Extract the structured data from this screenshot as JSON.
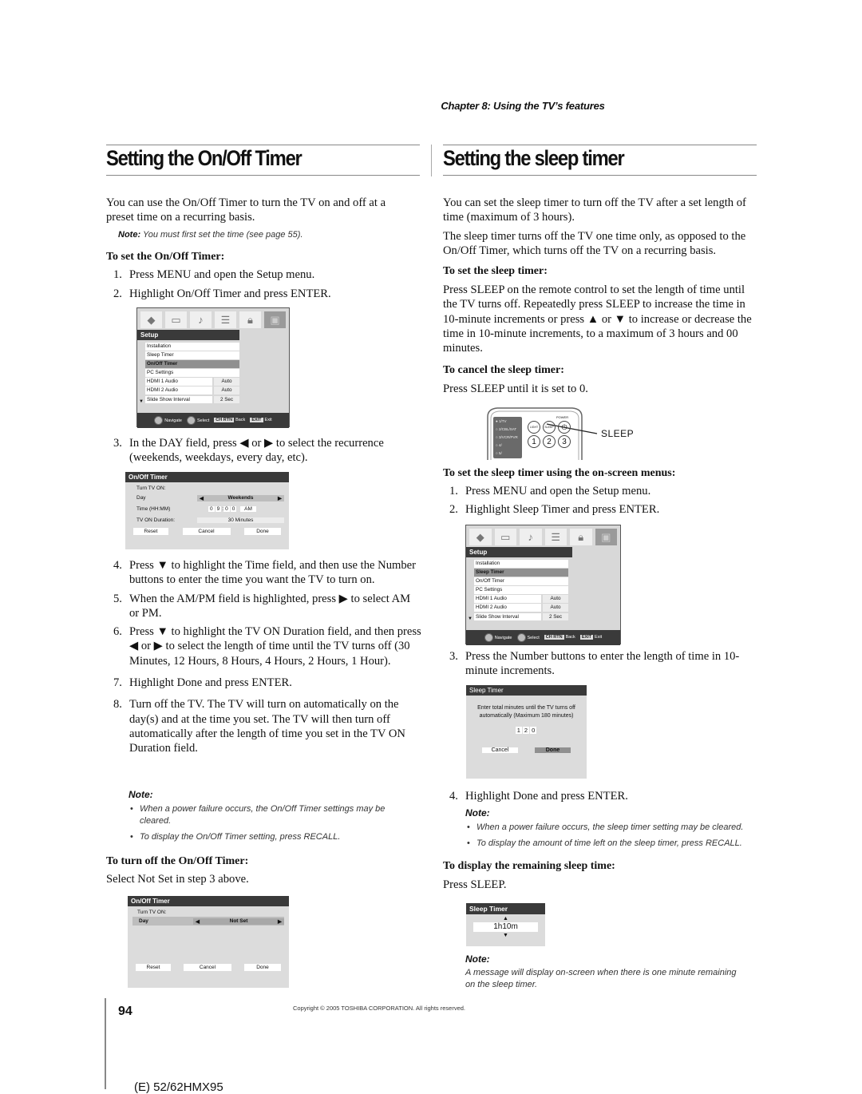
{
  "header": {
    "chapter": "Chapter 8: Using the TV’s features"
  },
  "left": {
    "title": "Setting the On/Off Timer",
    "intro": "You can use the On/Off Timer to turn the TV on and off at a preset time on a recurring basis.",
    "intro_line1": "You can use the On/Off Timer to turn the TV on and off at a",
    "intro_line2": "preset time on a recurring basis.",
    "note_label": "Note:",
    "note_text": "You must first set the time (see page 55).",
    "set_heading": "To set the On/Off Timer:",
    "steps_a": [
      {
        "n": "1.",
        "text": "Press MENU and open the Setup menu."
      },
      {
        "n": "2.",
        "text": "Highlight On/Off Timer and press ENTER."
      }
    ],
    "step3": {
      "n": "3.",
      "text": "In the DAY field, press ◀ or ▶ to select the recurrence (weekends, weekdays, every day, etc)."
    },
    "steps_b": [
      {
        "n": "4.",
        "text": "Press ▼ to highlight the Time field, and then use the Number buttons to enter the time you want the TV to turn on."
      },
      {
        "n": "5.",
        "text": "When the AM/PM field is highlighted, press ▶ to select AM or PM."
      },
      {
        "n": "6.",
        "text": "Press ▼ to highlight the TV ON Duration field, and then press ◀ or ▶ to select the length of time until the TV turns off (30 Minutes, 12 Hours, 8 Hours, 4 Hours, 2 Hours, 1 Hour)."
      },
      {
        "n": "7.",
        "text": "Highlight Done and press ENTER."
      },
      {
        "n": "8.",
        "text": "Turn off the TV. The TV will turn on automatically on the day(s) and at the time you set. The TV will then turn off automatically after the length of time you set in the TV ON Duration field."
      }
    ],
    "note2_label": "Note:",
    "note2_items": [
      "When a power failure occurs, the On/Off Timer settings may be cleared.",
      "To display the On/Off Timer setting, press RECALL."
    ],
    "turnoff_heading": "To turn off the On/Off Timer:",
    "turnoff_text": "Select Not Set in step 3 above."
  },
  "setup_menu_1": {
    "title": "Setup",
    "icons": [
      "picture-icon",
      "screen-icon",
      "music-note-icon",
      "settings-sliders-icon",
      "lock-icon",
      "setup-folder-icon"
    ],
    "items": [
      {
        "label": "Installation",
        "value": null
      },
      {
        "label": "Sleep Timer",
        "value": null
      },
      {
        "label": "On/Off Timer",
        "value": null,
        "highlighted": true
      },
      {
        "label": "PC Settings",
        "value": null
      },
      {
        "label": "HDMI 1 Audio",
        "value": "Auto"
      },
      {
        "label": "HDMI 2 Audio",
        "value": "Auto"
      },
      {
        "label": "Slide Show Interval",
        "value": "2 Sec"
      }
    ],
    "nav": {
      "navigate": "Navigate",
      "select": "Select",
      "back_key": "CH RTN",
      "back": "Back",
      "exit_key": "EXIT",
      "exit": "Exit"
    }
  },
  "onoff_dialog_1": {
    "title": "On/Off Timer",
    "turn_on_label": "Turn TV ON:",
    "day_label": "Day",
    "day_value": "Weekends",
    "time_label": "Time (HH:MM)",
    "time_digits": [
      "0",
      "9",
      "0",
      "0"
    ],
    "time_ampm": "AM",
    "duration_label": "TV ON Duration:",
    "duration_value": "30 Minutes",
    "buttons": [
      "Reset",
      "Cancel",
      "Done"
    ]
  },
  "onoff_dialog_2": {
    "title": "On/Off Timer",
    "turn_on_label": "Turn TV ON:",
    "day_label": "Day",
    "day_value": "Not Set",
    "buttons": [
      "Reset",
      "Cancel",
      "Done"
    ]
  },
  "right": {
    "title": "Setting the sleep timer",
    "intro1": "You can set the sleep timer to turn off the TV after a set length of time (maximum of 3 hours).",
    "intro2": "The sleep timer turns off the TV one time only, as opposed to the On/Off Timer, which turns off the TV on a recurring basis.",
    "set_heading": "To set the sleep timer:",
    "set_text": "Press SLEEP on the remote control to set the length of time until the TV turns off. Repeatedly press SLEEP to increase the time in 10-minute increments or press ▲ or ▼ to increase or decrease the time in 10-minute increments, to a maximum of 3 hours and 00 minutes.",
    "cancel_heading": "To cancel the sleep timer:",
    "cancel_text": "Press SLEEP until it is set to 0.",
    "menus_heading": "To set the sleep timer using the on-screen menus:",
    "steps_a": [
      {
        "n": "1.",
        "text": "Press MENU and open the Setup menu."
      },
      {
        "n": "2.",
        "text": "Highlight Sleep Timer and press ENTER."
      }
    ],
    "step3": {
      "n": "3.",
      "text": "Press the Number buttons to enter the length of time in 10-minute increments."
    },
    "step4": {
      "n": "4.",
      "text": "Highlight Done and press ENTER."
    },
    "note_label": "Note:",
    "note_items": [
      "When a power failure occurs, the sleep timer setting may be cleared.",
      "To display the amount of time left on the sleep timer, press RECALL."
    ],
    "display_heading": "To display the remaining sleep time:",
    "display_text": "Press SLEEP.",
    "note2_label": "Note:",
    "note2_text": "A message will display on-screen when there is one minute remaining on the sleep timer."
  },
  "remote": {
    "modes": [
      "1/TV",
      "2/CBL/SAT",
      "3/VCR/PVR",
      "4/",
      "5/"
    ],
    "buttons": [
      "LIGHT",
      "SLEEP",
      "POWER"
    ],
    "numbers": [
      "1",
      "2",
      "3"
    ],
    "callout": "SLEEP"
  },
  "setup_menu_2": {
    "title": "Setup",
    "items": [
      {
        "label": "Installation",
        "value": null
      },
      {
        "label": "Sleep Timer",
        "value": null,
        "highlighted": true
      },
      {
        "label": "On/Off Timer",
        "value": null
      },
      {
        "label": "PC Settings",
        "value": null
      },
      {
        "label": "HDMI 1 Audio",
        "value": "Auto"
      },
      {
        "label": "HDMI 2 Audio",
        "value": "Auto"
      },
      {
        "label": "Slide Show Interval",
        "value": "2 Sec"
      }
    ],
    "nav": {
      "navigate": "Navigate",
      "select": "Select",
      "back_key": "CH RTN",
      "back": "Back",
      "exit_key": "EXIT",
      "exit": "Exit"
    }
  },
  "sleep_dialog": {
    "title": "Sleep Timer",
    "message": "Enter total minutes until the TV turns off automatically (Maximum 180 minutes)",
    "digits": [
      "1",
      "2",
      "0"
    ],
    "buttons": [
      "Cancel",
      "Done"
    ]
  },
  "sleep_remaining": {
    "title": "Sleep Timer",
    "value": "1h10m"
  },
  "footer": {
    "page_number": "94",
    "copyright": "Copyright © 2005 TOSHIBA CORPORATION. All rights reserved.",
    "model": "(E) 52/62HMX95"
  }
}
